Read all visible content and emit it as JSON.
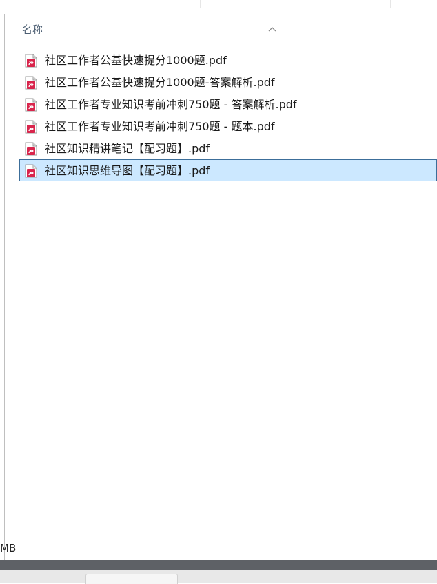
{
  "header": {
    "name_column": "名称"
  },
  "files": [
    {
      "name": "社区工作者公基快速提分1000题.pdf",
      "icon": "pdf-file-icon",
      "selected": false
    },
    {
      "name": "社区工作者公基快速提分1000题-答案解析.pdf",
      "icon": "pdf-file-icon",
      "selected": false
    },
    {
      "name": "社区工作者专业知识考前冲刺750题 - 答案解析.pdf",
      "icon": "pdf-file-icon",
      "selected": false
    },
    {
      "name": "社区工作者专业知识考前冲刺750题 - 题本.pdf",
      "icon": "pdf-file-icon",
      "selected": false
    },
    {
      "name": "社区知识精讲笔记【配习题】.pdf",
      "icon": "pdf-file-icon",
      "selected": false
    },
    {
      "name": "社区知识思维导图【配习题】.pdf",
      "icon": "pdf-file-icon",
      "selected": true
    }
  ],
  "status": {
    "size_fragment": "MB"
  },
  "colors": {
    "selection_bg": "#cce8ff",
    "selection_border": "#3c6e9a",
    "pdf_icon": "#d9254c"
  }
}
